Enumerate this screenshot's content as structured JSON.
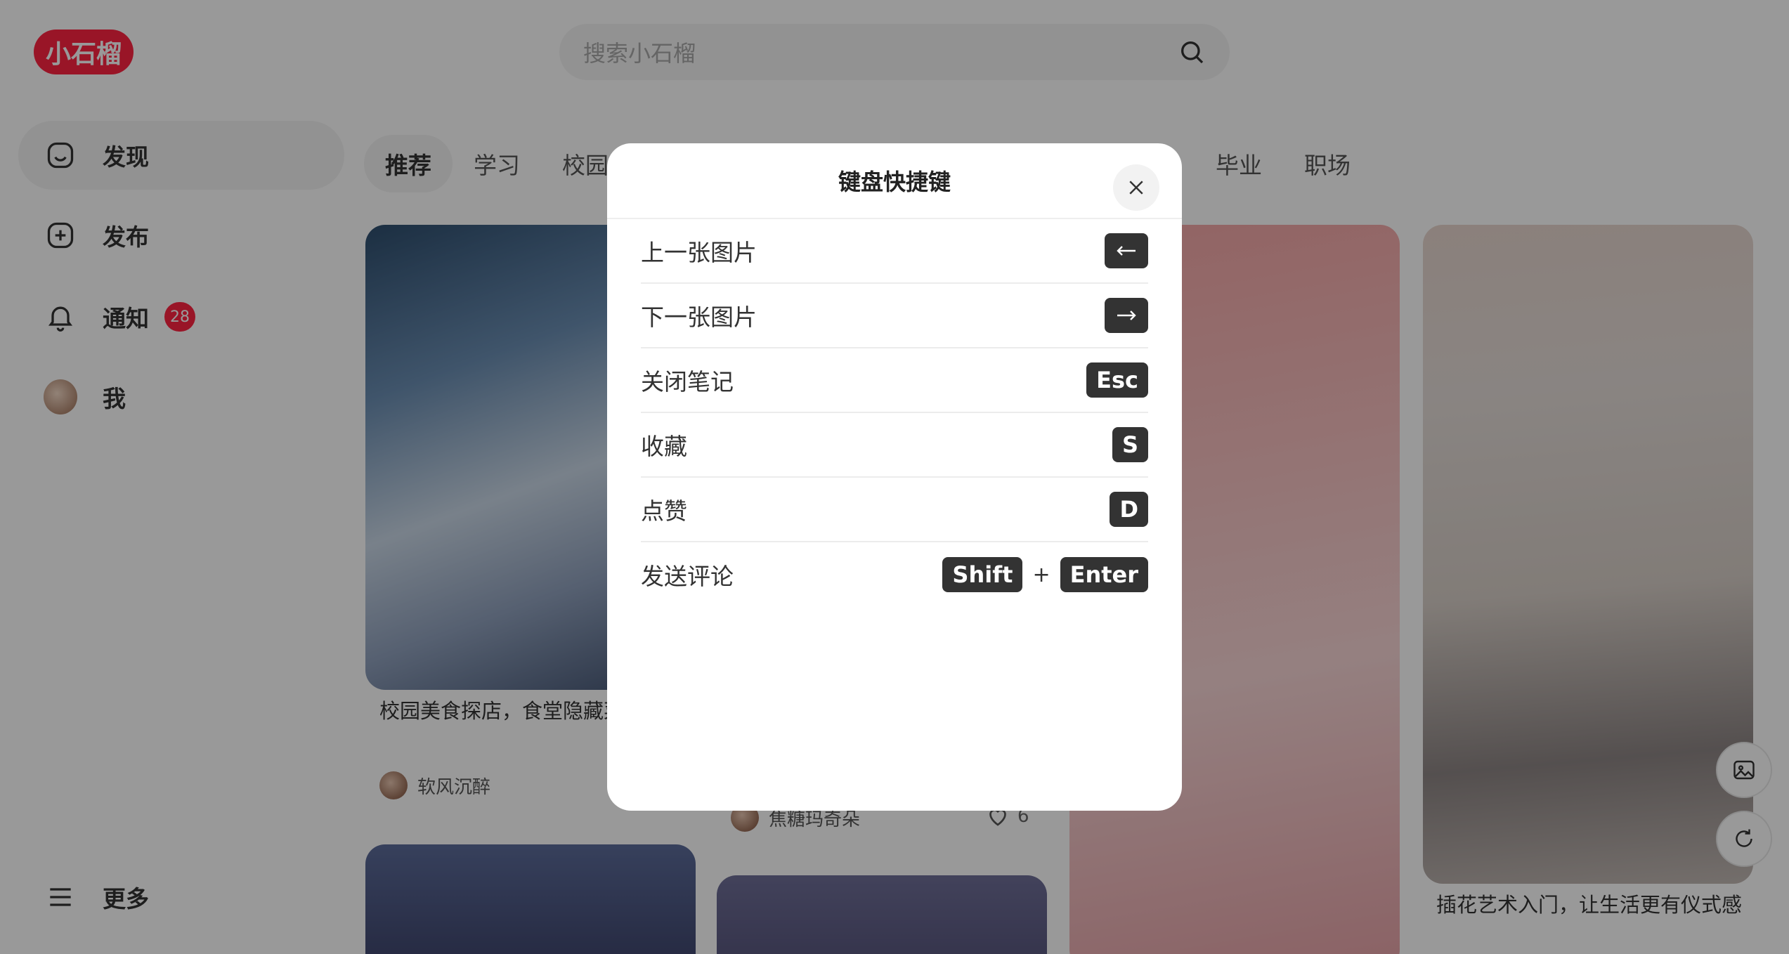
{
  "header": {
    "logo_text": "小石榴",
    "search_placeholder": "搜索小石榴"
  },
  "sidebar": {
    "items": [
      {
        "label": "发现",
        "icon": "home-icon",
        "active": true
      },
      {
        "label": "发布",
        "icon": "plus-square-icon"
      },
      {
        "label": "通知",
        "icon": "bell-icon",
        "badge": "28"
      },
      {
        "label": "我",
        "icon": "avatar"
      }
    ],
    "more_label": "更多"
  },
  "tabs": {
    "left": [
      "推荐",
      "学习",
      "校园"
    ],
    "right": [
      "毕业",
      "职场"
    ],
    "active": "推荐"
  },
  "feed": {
    "card1": {
      "title": "校园美食探店，食堂隐藏菜单公开",
      "author": "软风沉醉"
    },
    "card2": {
      "author": "焦糖玛奇朵",
      "likes": "6"
    },
    "card4": {
      "title": "插花艺术入门，让生活更有仪式感"
    }
  },
  "modal": {
    "title": "键盘快捷键",
    "shortcuts": [
      {
        "desc": "上一张图片",
        "key_icon": "arrow-left-icon"
      },
      {
        "desc": "下一张图片",
        "key_icon": "arrow-right-icon"
      },
      {
        "desc": "关闭笔记",
        "key": "Esc"
      },
      {
        "desc": "收藏",
        "key": "S"
      },
      {
        "desc": "点赞",
        "key": "D"
      },
      {
        "desc": "发送评论",
        "keys": [
          "Shift",
          "Enter"
        ],
        "separator": "+"
      }
    ]
  },
  "colors": {
    "brand": "#ff2442",
    "key_bg": "#333333",
    "overlay": "rgba(0,0,0,0.40)"
  }
}
